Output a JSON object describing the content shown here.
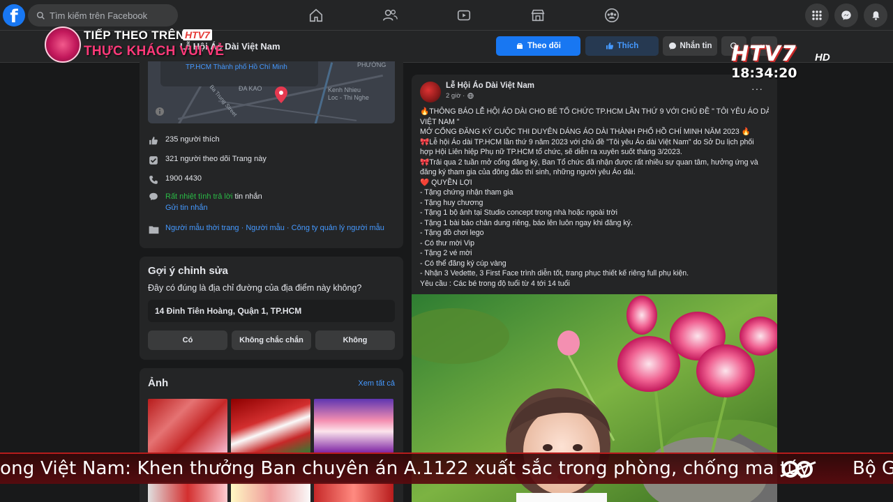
{
  "topbar": {
    "logo": "f",
    "search_placeholder": "Tìm kiếm trên Facebook",
    "nav": [
      "home-icon",
      "friends-icon",
      "watch-icon",
      "marketplace-icon",
      "groups-icon"
    ],
    "right": [
      "menu-grid-icon",
      "messenger-icon",
      "bell-icon"
    ]
  },
  "page_header": {
    "name": "Lễ Hội Áo Dài Việt Nam",
    "follow_label": "Theo dõi",
    "like_label": "Thích",
    "message_label": "Nhắn tin"
  },
  "info": {
    "map_address": "TP.HCM Thành phố Hồ Chí Minh",
    "map_labels": [
      "ĐA KAO",
      "PHƯỜNG",
      "Kenh Nhieu Loc - Thi Nghe",
      "Ba Trung Street"
    ],
    "likes": "235 người thích",
    "followers": "321 người theo dõi Trang này",
    "phone": "1900 4430",
    "response_green": "Rất nhiệt tình trả lời",
    "response_rest": "tin nhắn",
    "send_message": "Gửi tin nhắn",
    "categories": "Người mẫu thời trang · Người mẫu · Công ty quản lý người mẫu"
  },
  "suggest": {
    "title": "Gợi ý chỉnh sửa",
    "question": "Đây có đúng là địa chỉ đường của địa điểm này không?",
    "address": "14 Đinh Tiên Hoàng, Quận 1, TP.HCM",
    "yes": "Có",
    "unsure": "Không chắc chắn",
    "no": "Không"
  },
  "photos": {
    "title": "Ảnh",
    "see_all": "Xem tất cả"
  },
  "post": {
    "author": "Lễ Hội Áo Dài Việt Nam",
    "time": "2 giờ ·",
    "more": "···",
    "lines": [
      "🔥THÔNG BÁO LỄ HỘI ÁO DÀI CHO BÉ TỔ CHỨC TP.HCM LẦN THỨ 9 VỚI CHỦ ĐỀ \" TÔI YÊU ÁO DÀI",
      "VIỆT NAM \"",
      "MỞ CỔNG ĐĂNG KÝ CUỘC THI DUYÊN DÁNG ÁO DÀI THÀNH PHỐ HỒ CHÍ MINH NĂM 2023 🔥",
      "🎀Lễ hội Áo dài TP.HCM lần thứ 9 năm 2023 với chủ đề \"Tôi yêu Áo dài Việt Nam\" do Sở Du lịch phối",
      "hợp Hội Liên hiệp Phụ nữ TP.HCM tổ chức, sẽ diễn ra xuyên suốt tháng 3/2023.",
      "🎀Trải qua 2 tuần mở cổng đăng ký, Ban Tổ chức đã nhận được rất nhiều sự quan tâm, hưởng ứng và",
      "đăng ký tham gia của đông đảo thí sinh, những người yêu Áo dài.",
      "❤️ QUYỀN LỢI",
      "- Tặng chứng nhận tham gia",
      "- Tặng huy chương",
      "- Tặng 1 bộ ảnh tại Studio concept trong nhà hoặc ngoài trời",
      "- Tặng 1 bài báo chân dung riêng, báo lên luôn ngay khi đăng ký.",
      "- Tặng đồ chơi lego",
      "- Có thư mời Vip",
      "- Tặng 2 vé mời",
      "-  Có thể đăng ký cúp vàng",
      "- Nhận 3 Vedette, 3 First Face trình diễn tốt, trang phục thiết kế riêng full phụ kiện.",
      "Yêu cầu : Các bé trong độ tuổi từ 4 tới 14 tuổi"
    ]
  },
  "overlay": {
    "promo_line1": "TIẾP THEO TRÊN",
    "promo_channel": "HTV7",
    "promo_line2": "THỰC KHÁCH VUI VẺ",
    "channel_logo": "HTV7",
    "channel_hd": "HD",
    "clock": "18:34:20",
    "ticker": "ong Việt Nam: Khen thưởng Ban chuyên án A.1122 xuất sắc trong phòng, chống ma túy",
    "ticker_next": "Bộ G"
  },
  "colors": {
    "accent": "#1877f2",
    "link": "#4599ff",
    "background": "#18191a",
    "card": "#242526"
  }
}
